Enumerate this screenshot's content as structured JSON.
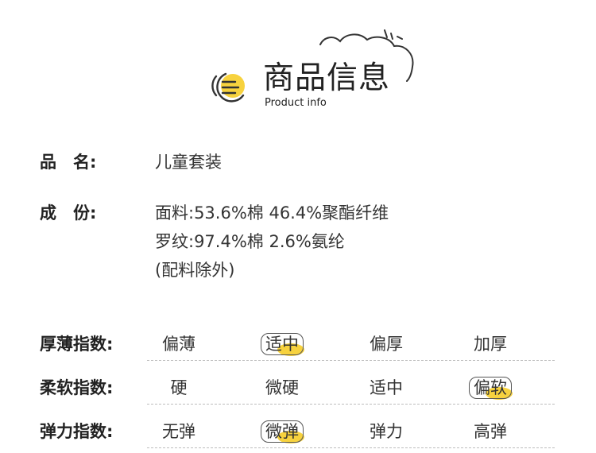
{
  "header": {
    "title": "商品信息",
    "subtitle": "Product info",
    "icon": "yellow-menu-circle-icon",
    "decoration": "cloud-doodle"
  },
  "colors": {
    "accent": "#f7d23e",
    "text": "#333333",
    "divider": "#bdbdbd"
  },
  "info": {
    "name_label": "品　名:",
    "name_value": "儿童套装",
    "composition_label": "成　份:",
    "composition_lines": [
      "面料:53.6%棉 46.4%聚酯纤维",
      "罗纹:97.4%棉 2.6%氨纶",
      "(配料除外)"
    ]
  },
  "indices": [
    {
      "label": "厚薄指数:",
      "options": [
        "偏薄",
        "适中",
        "偏厚",
        "加厚"
      ],
      "selected": 1
    },
    {
      "label": "柔软指数:",
      "options": [
        "硬",
        "微硬",
        "适中",
        "偏软"
      ],
      "selected": 3
    },
    {
      "label": "弹力指数:",
      "options": [
        "无弹",
        "微弹",
        "弹力",
        "高弹"
      ],
      "selected": 1
    }
  ]
}
